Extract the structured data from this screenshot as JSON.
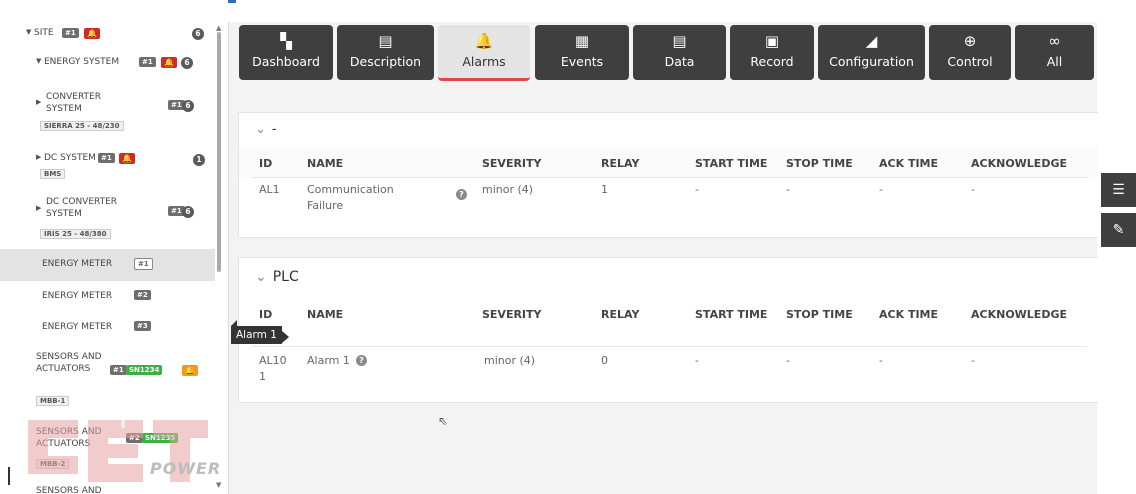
{
  "sidebar": {
    "items": [
      {
        "label": "SITE",
        "badges": [
          "#1"
        ],
        "count": "6"
      },
      {
        "label": "ENERGY SYSTEM",
        "badges": [
          "#1"
        ],
        "count": "6"
      },
      {
        "label": "CONVERTER SYSTEM",
        "badges": [
          "#1"
        ],
        "count": "6",
        "sub": "SIERRA 25 - 48/230"
      },
      {
        "label": "DC SYSTEM",
        "badges": [
          "#1"
        ],
        "count": "1",
        "sub": "BMS"
      },
      {
        "label": "DC CONVERTER SYSTEM",
        "badges": [
          "#1"
        ],
        "count": "6",
        "sub": "IRIS 25 - 48/380"
      },
      {
        "label": "ENERGY METER",
        "badges": [
          "#1"
        ]
      },
      {
        "label": "ENERGY METER",
        "badges": [
          "#2"
        ]
      },
      {
        "label": "ENERGY METER",
        "badges": [
          "#3"
        ]
      },
      {
        "label": "SENSORS AND ACTUATORS",
        "badges": [
          "#1",
          "SN1234"
        ],
        "sub": "MBB-1"
      },
      {
        "label": "SENSORS AND ACTUATORS",
        "badges": [
          "#2",
          "SN1235"
        ],
        "sub": "MBB-2"
      },
      {
        "label": "SENSORS AND"
      }
    ],
    "watermark": "POWER"
  },
  "tabs": [
    {
      "label": "Dashboard",
      "icon": "dashboard-icon",
      "glyph": "▚"
    },
    {
      "label": "Description",
      "icon": "document-icon",
      "glyph": "▤"
    },
    {
      "label": "Alarms",
      "icon": "bell-icon",
      "glyph": "🔔"
    },
    {
      "label": "Events",
      "icon": "calendar-icon",
      "glyph": "▦"
    },
    {
      "label": "Data",
      "icon": "data-icon",
      "glyph": "▤"
    },
    {
      "label": "Record",
      "icon": "record-icon",
      "glyph": "▣"
    },
    {
      "label": "Configuration",
      "icon": "wrench-icon",
      "glyph": "◢"
    },
    {
      "label": "Control",
      "icon": "control-icon",
      "glyph": "⊕"
    },
    {
      "label": "All",
      "icon": "infinity-icon",
      "glyph": "∞"
    }
  ],
  "groups": [
    {
      "title": "-",
      "columns": [
        "ID",
        "NAME",
        "SEVERITY",
        "RELAY",
        "START TIME",
        "STOP TIME",
        "ACK TIME",
        "ACKNOWLEDGE"
      ],
      "rows": [
        {
          "id": "AL1",
          "name_line1": "Communication",
          "name_line2": "Failure",
          "severity": "minor (4)",
          "relay": "1",
          "start": "-",
          "stop": "-",
          "ack": "-",
          "acknowledge": "-"
        }
      ]
    },
    {
      "title": "PLC",
      "columns": [
        "ID",
        "NAME",
        "SEVERITY",
        "RELAY",
        "START TIME",
        "STOP TIME",
        "ACK TIME",
        "ACKNOWLEDGE"
      ],
      "rows": [
        {
          "id_line1": "AL10",
          "id_line2": "1",
          "name": "Alarm 1",
          "severity": "minor (4)",
          "relay": "0",
          "start": "-",
          "stop": "-",
          "ack": "-",
          "acknowledge": "-"
        }
      ]
    }
  ],
  "tooltip": "Alarm 1",
  "colors": {
    "accent": "#e04848",
    "dark": "#3f3f3f",
    "alarm": "#d42828",
    "warning": "#f39a1d",
    "serial": "#3cb043"
  }
}
